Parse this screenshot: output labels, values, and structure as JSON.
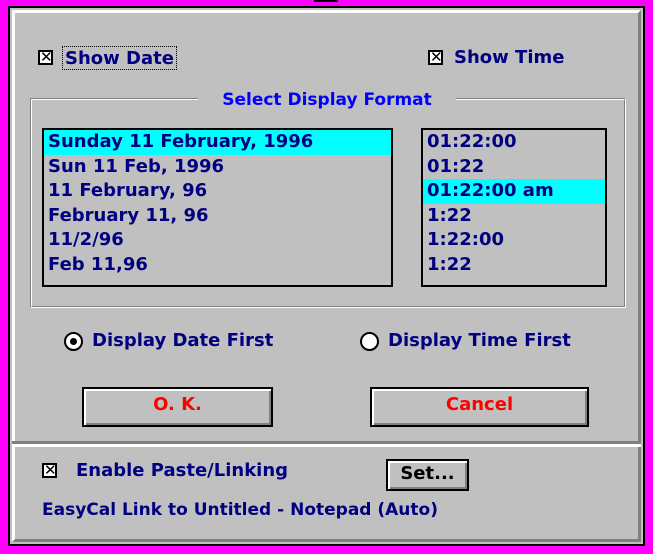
{
  "options": {
    "show_date_label": "Show Date",
    "show_date_checked": true,
    "show_time_label": "Show Time",
    "show_time_checked": true
  },
  "format_group": {
    "title": "Select Display Format",
    "date_formats": [
      "Sunday 11 February, 1996",
      "Sun 11 Feb, 1996",
      "11 February, 96",
      "February 11, 96",
      "11/2/96",
      "Feb 11,96"
    ],
    "date_selected_index": 0,
    "time_formats": [
      "01:22:00",
      "01:22",
      "01:22:00 am",
      "1:22",
      "1:22:00",
      "1:22"
    ],
    "time_selected_index": 2
  },
  "order": {
    "date_first_label": "Display Date First",
    "time_first_label": "Display Time First",
    "selected": "date_first"
  },
  "buttons": {
    "ok_label": "O. K.",
    "cancel_label": "Cancel",
    "set_label": "Set..."
  },
  "linking": {
    "enable_label": "Enable Paste/Linking",
    "enable_checked": true,
    "status_text": "EasyCal Link to Untitled - Notepad (Auto)"
  },
  "colors": {
    "background": "#ff00ff",
    "face": "#c0c0c0",
    "highlight": "#00ffff",
    "label_navy": "#000080",
    "group_title_blue": "#0000ff",
    "button_text_red": "#ff0000"
  }
}
